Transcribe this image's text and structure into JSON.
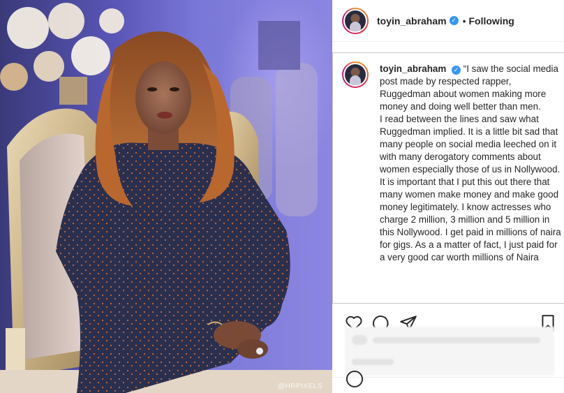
{
  "photo": {
    "watermark": "@HRPIXELS"
  },
  "header": {
    "username": "toyin_abraham",
    "separator": "•",
    "follow_label": "Following",
    "verified_glyph": "✓"
  },
  "caption": {
    "username": "toyin_abraham",
    "paragraphs": [
      "“I saw the social media post made by respected rapper, Ruggedman about women making more money and doing well better than men.",
      "I read between the lines and saw what Ruggedman implied. It is a little bit sad that many people on social media leeched on it with many derogatory comments about women especially those of us in Nollywood.",
      "It is important that I put this out there that many women make money and make good money legitimately. I know actresses who charge 2 million, 3 million and 5 million in this Nollywood. I get paid in millions of naira for gigs. As a a matter of fact, I just paid for a very good car worth millions of Naira"
    ]
  },
  "icons": {
    "like": "heart-icon",
    "comment": "comment-icon",
    "share": "share-icon",
    "save": "bookmark-icon"
  },
  "colors": {
    "verified": "#3897f0",
    "photo_background": "#6a66c8",
    "dress": "#2b2f4e"
  }
}
